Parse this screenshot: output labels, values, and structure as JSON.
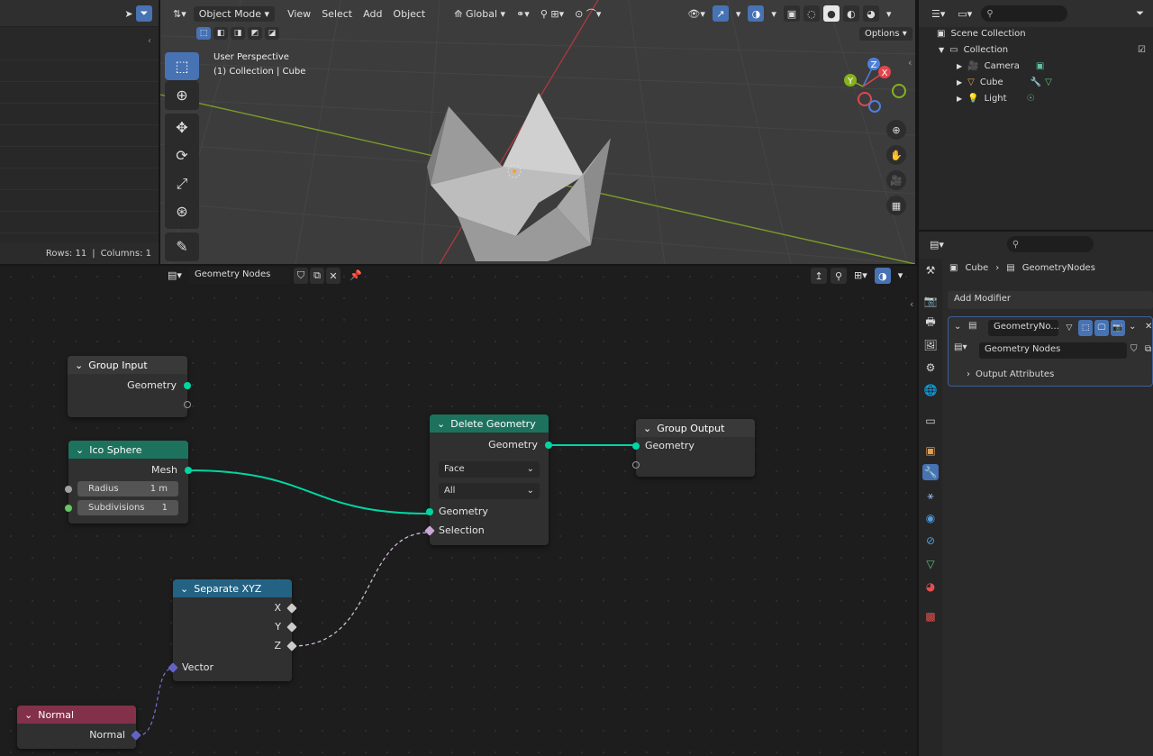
{
  "spreadsheet": {
    "rows_label": "Rows: 11",
    "columns_label": "Columns: 1",
    "separator": "|"
  },
  "viewport": {
    "header": {
      "mode": "Object Mode",
      "menu": [
        "View",
        "Select",
        "Add",
        "Object"
      ],
      "transform": "Global",
      "options": "Options"
    },
    "overlay_title": "User Perspective",
    "overlay_subtitle": "(1) Collection | Cube",
    "gizmo": {
      "x": "X",
      "y": "Y",
      "z": "Z"
    }
  },
  "node_editor": {
    "header": {
      "tree_name": "Geometry Nodes"
    },
    "nodes": {
      "group_input": {
        "title": "Group Input",
        "out_geometry": "Geometry"
      },
      "ico_sphere": {
        "title": "Ico Sphere",
        "out_mesh": "Mesh",
        "radius_label": "Radius",
        "radius_value": "1 m",
        "subdiv_label": "Subdivisions",
        "subdiv_value": "1"
      },
      "delete_geometry": {
        "title": "Delete Geometry",
        "out_geometry": "Geometry",
        "domain": "Face",
        "mode": "All",
        "in_geometry": "Geometry",
        "in_selection": "Selection"
      },
      "group_output": {
        "title": "Group Output",
        "in_geometry": "Geometry"
      },
      "separate_xyz": {
        "title": "Separate XYZ",
        "out_x": "X",
        "out_y": "Y",
        "out_z": "Z",
        "in_vector": "Vector"
      },
      "normal": {
        "title": "Normal",
        "out_normal": "Normal"
      }
    }
  },
  "outliner": {
    "scene_collection": "Scene Collection",
    "collection": "Collection",
    "items": [
      "Camera",
      "Cube",
      "Light"
    ]
  },
  "properties": {
    "breadcrumb": {
      "object": "Cube",
      "modifier": "GeometryNodes"
    },
    "add_modifier": "Add Modifier",
    "modifier_name": "GeometryNo...",
    "node_group": "Geometry Nodes",
    "output_attributes": "Output Attributes"
  },
  "colors": {
    "accent": "#4772b3",
    "geometry_socket": "#00d6a3",
    "input_header": "#1d725e",
    "converter_header": "#246283",
    "normal_header": "#83314a"
  }
}
